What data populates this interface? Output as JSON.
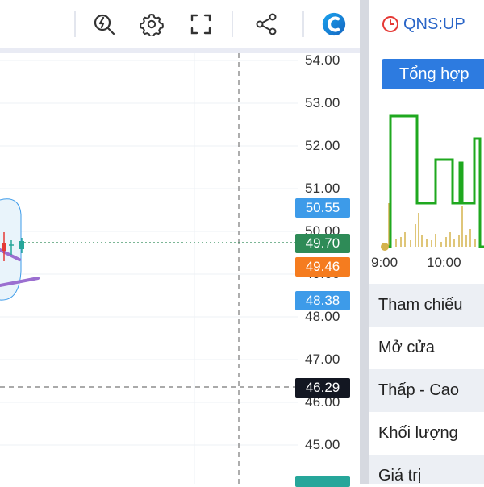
{
  "toolbar": {
    "icons": [
      "quick-analysis-icon",
      "settings-icon",
      "fullscreen-icon",
      "share-icon",
      "app-logo-icon"
    ],
    "accent": "#1e88e5"
  },
  "chart": {
    "price_axis": [
      "54.00",
      "53.00",
      "52.00",
      "51.00",
      "50.00",
      "49.00",
      "48.00",
      "47.00",
      "46.00",
      "45.00"
    ],
    "tags": {
      "high": {
        "text": "50.55",
        "color": "#3d9be9"
      },
      "last": {
        "text": "49.70",
        "color": "#2e8b57"
      },
      "ref": {
        "text": "49.46",
        "color": "#f57c1f"
      },
      "low": {
        "text": "48.38",
        "color": "#3d9be9"
      },
      "crosshair": {
        "text": "46.29",
        "color": "#131722"
      },
      "bottom": {
        "text": "",
        "color": "#26a69a"
      }
    }
  },
  "panel": {
    "symbol": "QNS:UP",
    "tab_label": "Tổng hợp",
    "time_labels": [
      "9:00",
      "10:00"
    ],
    "rows": [
      "Tham chiếu",
      "Mở cửa",
      "Thấp - Cao",
      "Khối lượng",
      "Giá trị"
    ],
    "colors": {
      "line": "#1fa81f",
      "volume": "#d4b24c"
    }
  }
}
